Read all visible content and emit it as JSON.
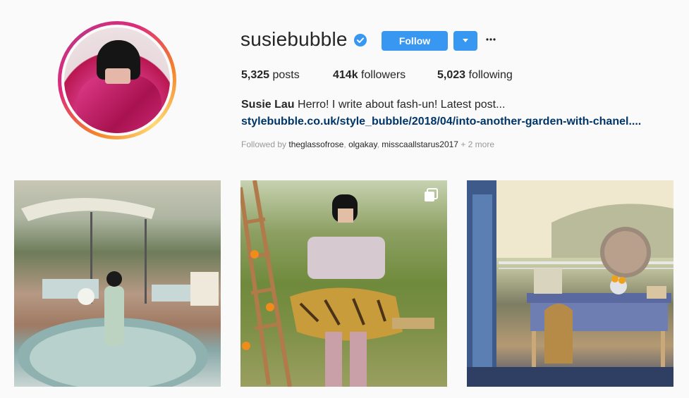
{
  "profile": {
    "username": "susiebubble",
    "follow_label": "Follow",
    "stats": {
      "posts_count": "5,325",
      "posts_label": "posts",
      "followers_count": "414k",
      "followers_label": "followers",
      "following_count": "5,023",
      "following_label": "following"
    },
    "bio": {
      "name": "Susie Lau",
      "text": "Herro! I write about fash-un! Latest post...",
      "link": "stylebubble.co.uk/style_bubble/2018/04/into-another-garden-with-chanel...."
    },
    "followed_by": {
      "prefix": "Followed by",
      "accounts": [
        "theglassofrose",
        "olgakay",
        "misscaallstarus2017"
      ],
      "more": "+ 2 more"
    }
  },
  "colors": {
    "accent": "#3897f0",
    "link": "#003569",
    "muted": "#999999"
  },
  "icons": {
    "verified": "verified-badge-icon",
    "dropdown": "caret-down-icon",
    "more": "ellipsis-icon",
    "multi": "carousel-icon"
  }
}
